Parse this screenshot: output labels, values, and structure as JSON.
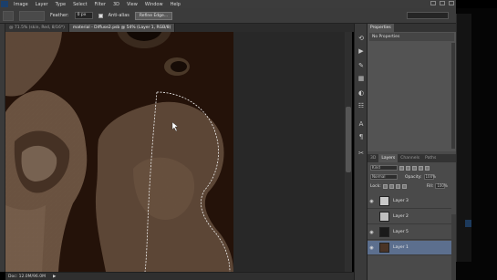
{
  "menubar": {
    "items": [
      "Image",
      "Layer",
      "Type",
      "Select",
      "Filter",
      "3D",
      "View",
      "Window",
      "Help"
    ]
  },
  "options": {
    "feather_label": "Feather:",
    "feather_value": "0 px",
    "antialias_label": "Anti-alias",
    "refine_edge_label": "Refine Edge..."
  },
  "tabs": [
    {
      "label": "@ 71.5% (skin, Red, 8/16*)",
      "active": false
    },
    {
      "label": "material - Diffuse2.psb @ 54% (Layer 1, RGB/8)",
      "active": true
    }
  ],
  "status": {
    "doc_size": "Doc: 12.0M/96.0M",
    "arrow": "▶"
  },
  "properties": {
    "tabs": [
      "Properties"
    ],
    "subtitle": "No Properties"
  },
  "layers_panel": {
    "tabs": [
      "3D",
      "Layers",
      "Channels",
      "Paths"
    ],
    "kind_label": "Kind",
    "blend_mode": "Normal",
    "opacity_label": "Opacity:",
    "opacity_value": "100%",
    "lock_label": "Lock:",
    "fill_label": "Fill:",
    "fill_value": "100%",
    "layers": [
      {
        "name": "Layer 3",
        "visible": true,
        "selected": false
      },
      {
        "name": "Layer 2",
        "visible": false,
        "selected": false
      },
      {
        "name": "Layer 5",
        "visible": true,
        "selected": false
      },
      {
        "name": "Layer 1",
        "visible": true,
        "selected": true
      }
    ]
  },
  "iconstrip": {
    "icons": [
      "history-icon",
      "actions-icon",
      "brush-presets-icon",
      "swatches-icon",
      "adjustments-icon",
      "styles-icon",
      "character-icon",
      "paragraph-icon",
      "tool-presets-icon"
    ]
  },
  "colors": {
    "doc_bg": "#241209",
    "selected_layer": "#5c6f8e",
    "panel_bg": "#4a4a4a"
  }
}
